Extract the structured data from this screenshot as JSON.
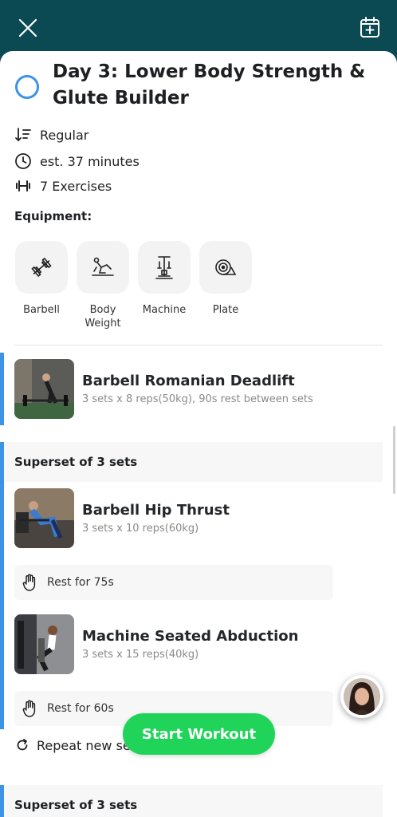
{
  "workout": {
    "title": "Day 3: Lower Body Strength & Glute Builder",
    "difficulty": "Regular",
    "duration": "est. 37 minutes",
    "exercise_count": "7 Exercises"
  },
  "equipment": {
    "heading": "Equipment:",
    "items": [
      {
        "label": "Barbell",
        "icon": "barbell-icon"
      },
      {
        "label": "Body Weight",
        "icon": "body-weight-icon"
      },
      {
        "label": "Machine",
        "icon": "machine-icon"
      },
      {
        "label": "Plate",
        "icon": "plate-icon"
      }
    ]
  },
  "exercises": [
    {
      "name": "Barbell Romanian Deadlift",
      "detail": "3 sets x 8 reps(50kg), 90s rest between sets"
    },
    {
      "name": "Barbell Hip Thrust",
      "detail": "3 sets x 10 reps(60kg)"
    },
    {
      "name": "Machine Seated Abduction",
      "detail": "3 sets x 15 reps(40kg)"
    }
  ],
  "supersets": [
    {
      "label": "Superset of 3 sets"
    },
    {
      "label": "Superset of 3 sets"
    }
  ],
  "rests": [
    {
      "label": "Rest for 75s"
    },
    {
      "label": "Rest for 60s"
    }
  ],
  "repeat_label": "Repeat new se",
  "start_button": "Start Workout",
  "colors": {
    "header_bg": "#0b4a52",
    "accent_blue": "#3d93e6",
    "start_green": "#20d45a"
  }
}
